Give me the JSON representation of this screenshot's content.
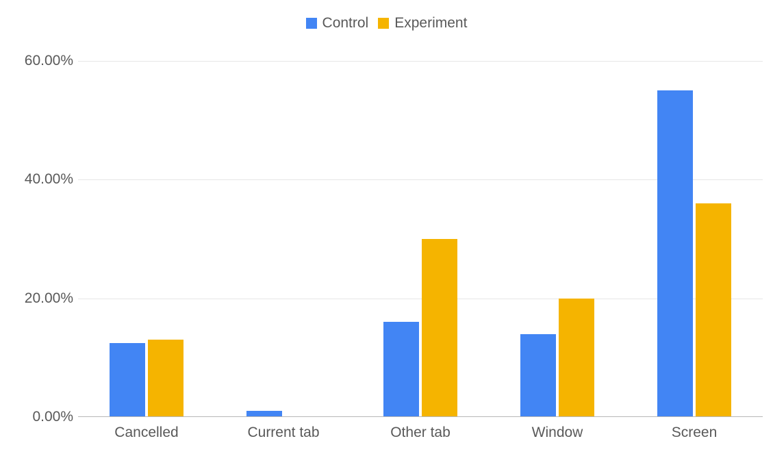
{
  "chart_data": {
    "type": "bar",
    "categories": [
      "Cancelled",
      "Current tab",
      "Other tab",
      "Window",
      "Screen"
    ],
    "series": [
      {
        "name": "Control",
        "color": "#4285f4",
        "values": [
          12.5,
          1.0,
          16.0,
          14.0,
          55.0
        ]
      },
      {
        "name": "Experiment",
        "color": "#f5b400",
        "values": [
          13.0,
          0.0,
          30.0,
          20.0,
          36.0
        ]
      }
    ],
    "ylabel": "",
    "xlabel": "",
    "title": "",
    "ylim": [
      0,
      60
    ],
    "y_ticks": [
      0,
      20,
      40,
      60
    ],
    "y_tick_labels": [
      "0.00%",
      "20.00%",
      "40.00%",
      "60.00%"
    ],
    "grid": true,
    "legend_position": "top"
  }
}
